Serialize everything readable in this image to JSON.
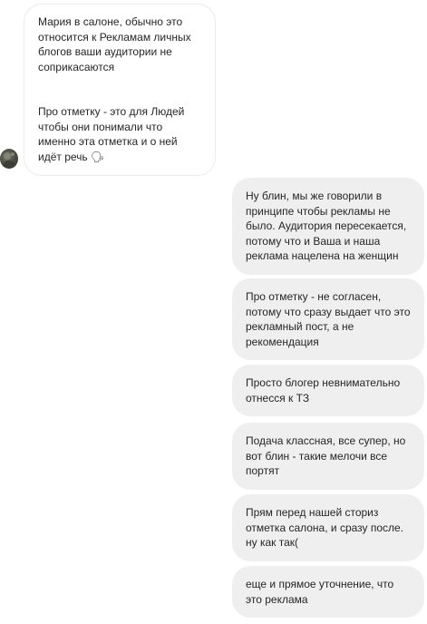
{
  "conversation": {
    "incoming_messages": [
      {
        "text": "Мария в салоне, обычно это относится к Рекламам личных блогов ваши аудитории не соприкасаются\n\n\nПро отметку - это для Людей чтобы они понимали что именно эта отметка и о ней идёт речь 🗣"
      }
    ],
    "outgoing_messages": [
      {
        "text": "Ну блин, мы же говорили в принципе чтобы рекламы не было. Аудитория пересекается, потому что и Ваша и наша реклама нацелена на женщин"
      },
      {
        "text": "Про отметку - не согласен, потому что сразу выдает что это рекламный пост, а не рекомендация"
      },
      {
        "text": "Просто блогер невнимательно отнесся к ТЗ"
      },
      {
        "text": "Подача классная, все супер, но вот блин - такие мелочи все портят"
      },
      {
        "text": "Прям перед нашей сториз отметка салона, и сразу после. ну как так("
      },
      {
        "text": "еще и прямое уточнение, что это реклама"
      }
    ]
  },
  "colors": {
    "outgoing_bubble": "#efefef",
    "incoming_bubble_border": "#ececec",
    "text": "#262626"
  }
}
